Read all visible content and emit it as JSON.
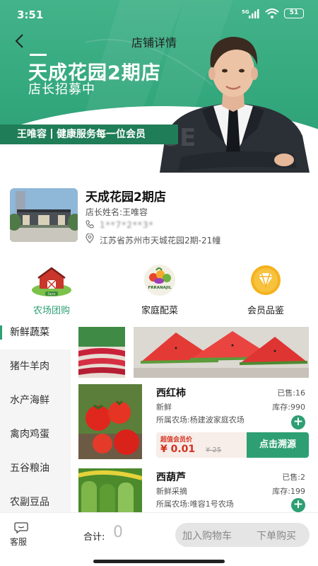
{
  "status_bar": {
    "time": "3:51",
    "network": "5G",
    "battery": "51"
  },
  "header": {
    "title": "店铺详情"
  },
  "promo": {
    "store_name": "天成花园2期店",
    "subtitle": "店长招募中",
    "watermark": "INTRODUCE",
    "manager_name": "王唯容",
    "slogan": "健康服务每一位会员"
  },
  "store": {
    "name": "天成花园2期店",
    "manager": "店长姓名:王唯容",
    "phone": "1**7*2**3*",
    "address": "江苏省苏州市天城花园2期-21幢"
  },
  "categories": [
    {
      "label": "农场团购",
      "icon": "farm-barn-icon"
    },
    {
      "label": "家庭配菜",
      "icon": "fresh-basket-icon"
    },
    {
      "label": "会员品鉴",
      "icon": "member-diamond-icon"
    }
  ],
  "category_badge": {
    "farm": "Farm",
    "fresh": "FRRANAJIL"
  },
  "sidebar": {
    "items": [
      {
        "label": "新鲜蔬菜"
      },
      {
        "label": "猪牛羊肉"
      },
      {
        "label": "水产海鲜"
      },
      {
        "label": "禽肉鸡蛋"
      },
      {
        "label": "五谷粮油"
      },
      {
        "label": "农副豆品"
      }
    ]
  },
  "products": [
    {
      "name": "西红柿",
      "sold": "已售:16",
      "desc": "新鲜",
      "stock": "库存:990",
      "farm": "所属农场:杨建波家庭农场",
      "deal_tag": "超值会员价",
      "price": "¥ 0.01",
      "original_price": "¥ 25",
      "trace_button": "点击溯源"
    },
    {
      "name": "西葫芦",
      "sold": "已售:2",
      "desc": "新鲜采摘",
      "stock": "库存:199",
      "farm": "所属农场:唯容1号农场"
    }
  ],
  "bottom_bar": {
    "service_label": "客服",
    "total_label": "合计:",
    "total_value": "0",
    "add_cart_label": "加入购物车",
    "buy_label": "下单购买"
  },
  "colors": {
    "brand_green": "#2e9f73",
    "price_red": "#d6301f",
    "band_green": "#1f7d57"
  }
}
